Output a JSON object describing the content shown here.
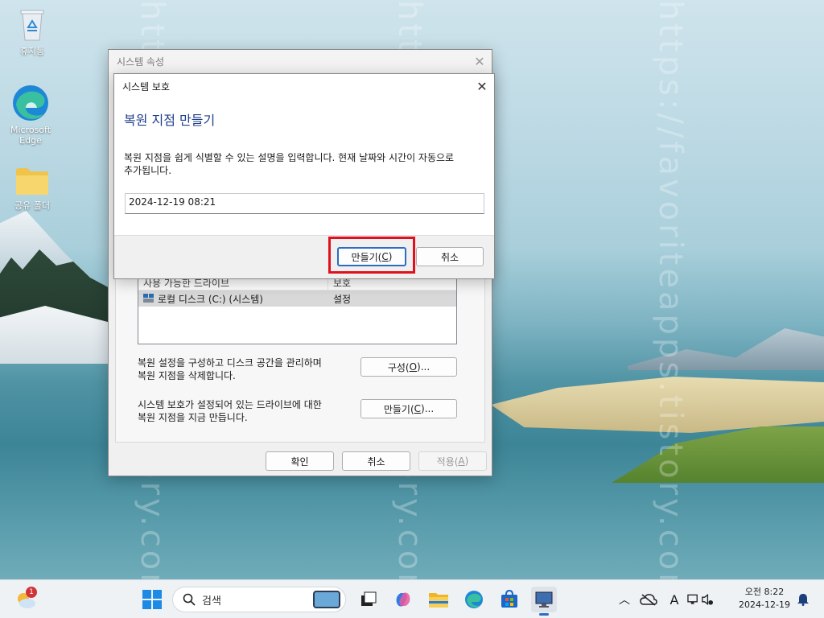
{
  "desktop": {
    "icons": [
      {
        "label": "휴지통"
      },
      {
        "label": "Microsoft Edge"
      },
      {
        "label": "공유 폴더"
      }
    ],
    "watermark": "https://favoriteapps.tistory.com/"
  },
  "system_properties": {
    "title": "시스템 속성",
    "drive_header_name": "사용 가능한 드라이브",
    "drive_header_status": "보호",
    "drive_row_name": "로컬 디스크 (C:) (시스템)",
    "drive_row_status": "설정",
    "configure_text_line1": "복원 설정을 구성하고 디스크 공간을 관리하며",
    "configure_text_line2": "복원 지점을 삭제합니다.",
    "configure_button_pre": "구성(",
    "configure_button_key": "O",
    "configure_button_post": ")...",
    "create_text_line1": "시스템 보호가 설정되어 있는 드라이브에 대한",
    "create_text_line2": "복원 지점을 지금 만듭니다.",
    "create_button_pre": "만들기(",
    "create_button_key": "C",
    "create_button_post": ")...",
    "ok_label": "확인",
    "cancel_label": "취소",
    "apply_pre": "적용(",
    "apply_key": "A",
    "apply_post": ")"
  },
  "system_protection": {
    "title": "시스템 보호",
    "heading": "복원 지점 만들기",
    "description_line1": "복원 지점을 쉽게 식별할 수 있는 설명을 입력합니다. 현재 날짜와 시간이 자동으로",
    "description_line2": "추가됩니다.",
    "input_value": "2024-12-19 08:21",
    "create_pre": "만들기(",
    "create_key": "C",
    "create_post": ")",
    "cancel_label": "취소",
    "highlight_color": "#e0111b"
  },
  "taskbar": {
    "weather_badge": "1",
    "search_placeholder": "검색",
    "clock_time": "오전 8:22",
    "clock_date": "2024-12-19",
    "apps": [
      "windows-start",
      "task-view",
      "copilot",
      "file-explorer",
      "edge",
      "microsoft-store",
      "system-properties"
    ]
  }
}
